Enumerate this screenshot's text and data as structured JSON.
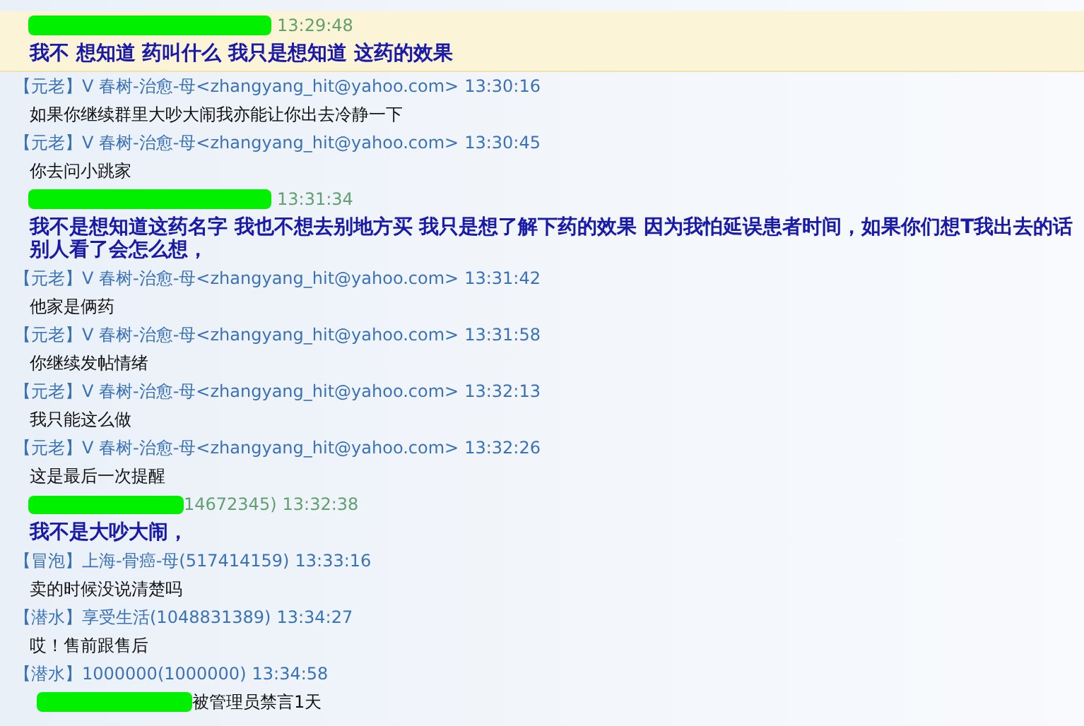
{
  "messages": [
    {
      "header": {
        "kind": "redacted",
        "time": "13:29:48"
      },
      "body": "我不  想知道  药叫什么     我只是想知道  这药的效果",
      "bold": true,
      "selected": true
    },
    {
      "header": {
        "kind": "member",
        "badge": "【元老】",
        "sender": "V 春树-治愈-母<zhangyang_hit@yahoo.com>",
        "time": "13:30:16"
      },
      "body": "如果你继续群里大吵大闹我亦能让你出去冷静一下",
      "bold": false,
      "selected": false
    },
    {
      "header": {
        "kind": "member",
        "badge": "【元老】",
        "sender": "V 春树-治愈-母<zhangyang_hit@yahoo.com>",
        "time": "13:30:45"
      },
      "body": "你去问小跳家",
      "bold": false,
      "selected": false
    },
    {
      "header": {
        "kind": "redacted",
        "time": "13:31:34"
      },
      "body": "我不是想知道这药名字  我也不想去别地方买  我只是想了解下药的效果    因为我怕延误患者时间，如果你们想T我出去的话别人看了会怎么想，",
      "bold": true,
      "selected": false
    },
    {
      "header": {
        "kind": "member",
        "badge": "【元老】",
        "sender": "V 春树-治愈-母<zhangyang_hit@yahoo.com>",
        "time": "13:31:42"
      },
      "body": "他家是俩药",
      "bold": false,
      "selected": false
    },
    {
      "header": {
        "kind": "member",
        "badge": "【元老】",
        "sender": "V 春树-治愈-母<zhangyang_hit@yahoo.com>",
        "time": "13:31:58"
      },
      "body": "你继续发帖情绪",
      "bold": false,
      "selected": false
    },
    {
      "header": {
        "kind": "member",
        "badge": "【元老】",
        "sender": "V 春树-治愈-母<zhangyang_hit@yahoo.com>",
        "time": "13:32:13"
      },
      "body": "我只能这么做",
      "bold": false,
      "selected": false
    },
    {
      "header": {
        "kind": "member",
        "badge": "【元老】",
        "sender": "V 春树-治愈-母<zhangyang_hit@yahoo.com>",
        "time": "13:32:26"
      },
      "body": "这是最后一次提醒",
      "bold": false,
      "selected": false
    },
    {
      "header": {
        "kind": "redacted",
        "tail": "14672345)",
        "time": "13:32:38"
      },
      "body": "我不是大吵大闹，",
      "bold": true,
      "selected": false
    },
    {
      "header": {
        "kind": "member",
        "badge": "【冒泡】",
        "sender": "上海-骨癌-母(517414159)",
        "time": "13:33:16"
      },
      "body": "卖的时候没说清楚吗",
      "bold": false,
      "selected": false
    },
    {
      "header": {
        "kind": "member",
        "badge": "【潜水】",
        "sender": "享受生活(1048831389)",
        "time": "13:34:27"
      },
      "body": "哎！售前跟售后",
      "bold": false,
      "selected": false
    },
    {
      "header": {
        "kind": "member",
        "badge": "【潜水】",
        "sender": "1000000(1000000)",
        "time": "13:34:58"
      },
      "notice": "被管理员禁言1天",
      "selected": false
    }
  ]
}
